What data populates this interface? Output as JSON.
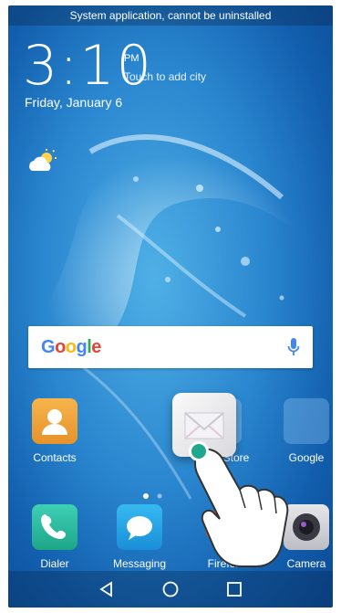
{
  "status_bar": {
    "message": "System application, cannot be uninstalled"
  },
  "clock": {
    "time": "3:10",
    "ampm": "PM",
    "city_hint": "Touch to add city",
    "date": "Friday, January 6"
  },
  "search": {
    "brand": [
      "G",
      "o",
      "o",
      "g",
      "l",
      "e"
    ],
    "brand_colors": [
      "#4285f4",
      "#ea4335",
      "#fbbc05",
      "#4285f4",
      "#34a853",
      "#ea4335"
    ]
  },
  "apps_row1": [
    {
      "label": "Contacts"
    },
    {
      "label": "ay Store"
    },
    {
      "label": "Google"
    }
  ],
  "apps_row2": [
    {
      "label": "Dialer"
    },
    {
      "label": "Messaging"
    },
    {
      "label": "Firefox"
    },
    {
      "label": "Camera"
    }
  ],
  "dragging_app": {
    "icon": "email-icon"
  },
  "navbar": {
    "back": "back-icon",
    "home": "home-icon",
    "recents": "recents-icon"
  }
}
